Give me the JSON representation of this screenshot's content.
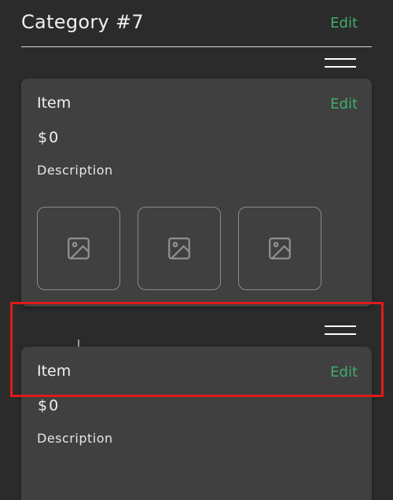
{
  "category": {
    "title": "Category #7",
    "edit_label": "Edit"
  },
  "items": [
    {
      "name": "Item",
      "edit_label": "Edit",
      "price": "$0",
      "description": "Description",
      "images": [
        "image-placeholder-icon",
        "image-placeholder-icon",
        "image-placeholder-icon"
      ]
    },
    {
      "name": "Item",
      "edit_label": "Edit",
      "price": "$0",
      "description": "Description"
    }
  ],
  "colors": {
    "background": "#2b2b2b",
    "card": "#404040",
    "accent": "#3fae6a",
    "highlight": "#e01b1b"
  },
  "icons": {
    "drag_handle": "drag-handle-icon",
    "image_placeholder": "image-placeholder-icon"
  }
}
